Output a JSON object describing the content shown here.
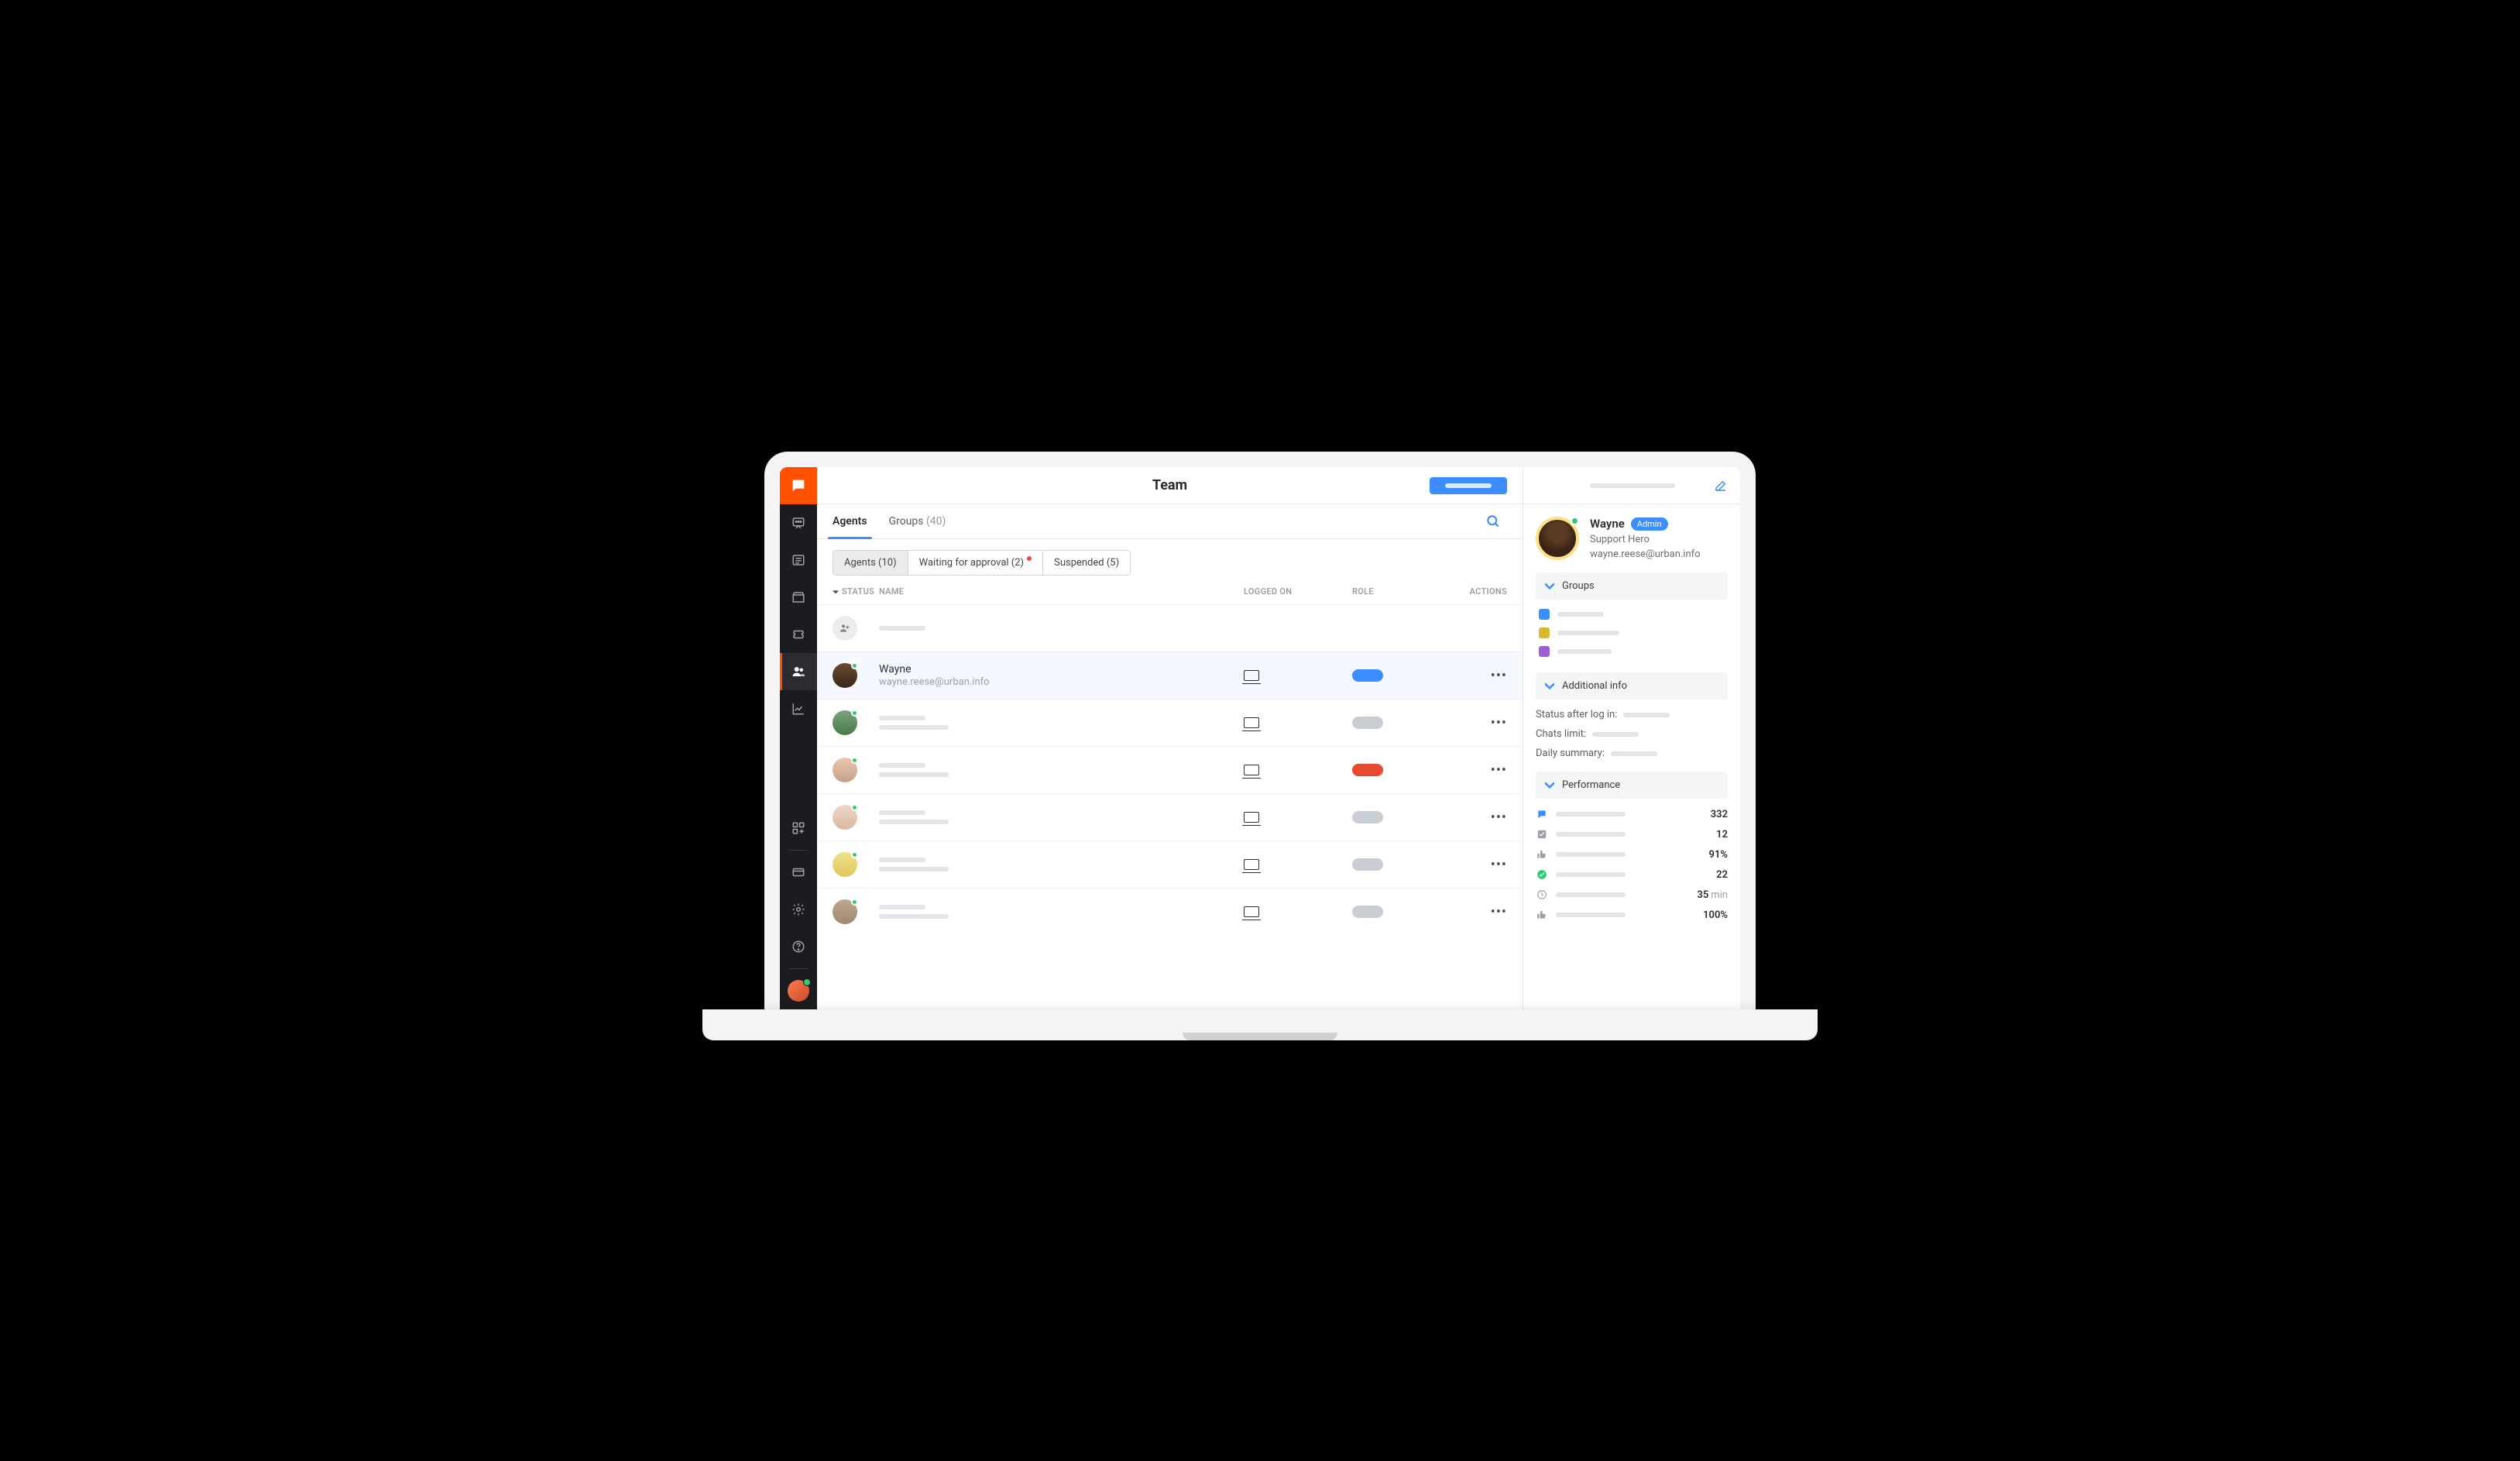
{
  "header": {
    "title": "Team"
  },
  "tabs": {
    "agents": "Agents",
    "groups_label": "Groups",
    "groups_count": "(40)"
  },
  "filters": {
    "agents": "Agents (10)",
    "waiting": "Waiting for approval (2)",
    "suspended": "Suspended (5)"
  },
  "columns": {
    "status": "STATUS",
    "name": "NAME",
    "logged": "LOGGED ON",
    "role": "ROLE",
    "actions": "ACTIONS"
  },
  "rows": [
    {
      "name": "Wayne",
      "email": "wayne.reese@urban.info",
      "role": "blue",
      "selected": true
    },
    {
      "role": "gray"
    },
    {
      "role": "red"
    },
    {
      "role": "gray"
    },
    {
      "role": "gray"
    },
    {
      "role": "gray"
    }
  ],
  "detail": {
    "name": "Wayne",
    "badge": "Admin",
    "role_title": "Support Hero",
    "email": "wayne.reese@urban.info",
    "sections": {
      "groups": "Groups",
      "additional": "Additional info",
      "performance": "Performance"
    },
    "group_colors": [
      "#3c8dff",
      "#d6b92f",
      "#9b5fd0"
    ],
    "info": {
      "status_after_login": "Status after log in:",
      "chats_limit": "Chats limit:",
      "daily_summary": "Daily summary:"
    },
    "perf": [
      {
        "value": "332",
        "unit": ""
      },
      {
        "value": "12",
        "unit": ""
      },
      {
        "value": "91%",
        "unit": ""
      },
      {
        "value": "22",
        "unit": ""
      },
      {
        "value": "35",
        "unit": "min"
      },
      {
        "value": "100%",
        "unit": ""
      }
    ]
  }
}
